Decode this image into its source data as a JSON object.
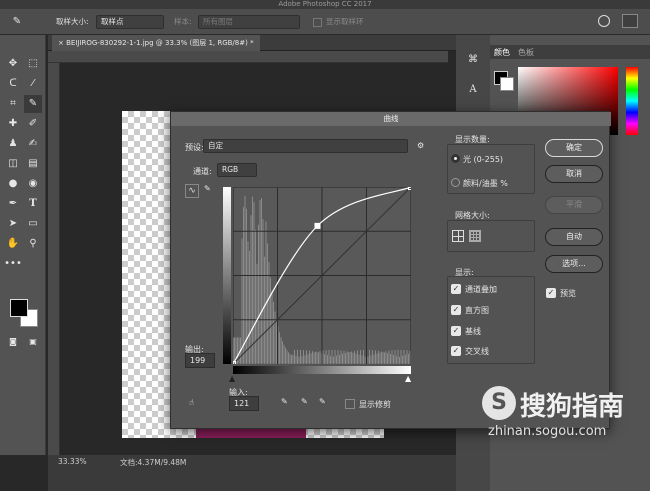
{
  "app_title": "Adobe Photoshop CC 2017",
  "options_bar": {
    "sample_size_label": "取样大小:",
    "sample_size_value": "取样点",
    "sample_label": "样本:",
    "sample_value": "所有图层",
    "show_ring_label": "显示取样环"
  },
  "document": {
    "tab_title": "BEIJIROG-830292-1-1.jpg @ 33.3% (图层 1, RGB/8#) *",
    "zoom": "33.33%",
    "doc_size": "文档:4.37M/9.48M"
  },
  "right_panel": {
    "tab_color": "颜色",
    "tab_swatches": "色板"
  },
  "curves": {
    "title": "曲线",
    "preset_label": "预设:",
    "preset_value": "自定",
    "channel_label": "通道:",
    "channel_value": "RGB",
    "output_label": "输出:",
    "output_value": "199",
    "input_label": "输入:",
    "input_value": "121",
    "show_clipping_label": "显示修剪",
    "display_amount": {
      "title": "显示数量:",
      "light": "光 (0-255)",
      "pigment": "颜料/油墨 %"
    },
    "grid_size": {
      "title": "网格大小:"
    },
    "show": {
      "title": "显示:",
      "channel_overlays": "通道叠加",
      "histogram": "直方图",
      "baseline": "基线",
      "intersection": "交叉线"
    },
    "buttons": {
      "ok": "确定",
      "cancel": "取消",
      "smooth": "平滑",
      "auto": "自动",
      "options": "选项..."
    },
    "preview_label": "预览",
    "curve_points": [
      [
        0,
        0
      ],
      [
        121,
        199
      ],
      [
        255,
        255
      ]
    ]
  },
  "watermark": {
    "brand": "搜狗指南",
    "url": "zhinan.sogou.com"
  }
}
